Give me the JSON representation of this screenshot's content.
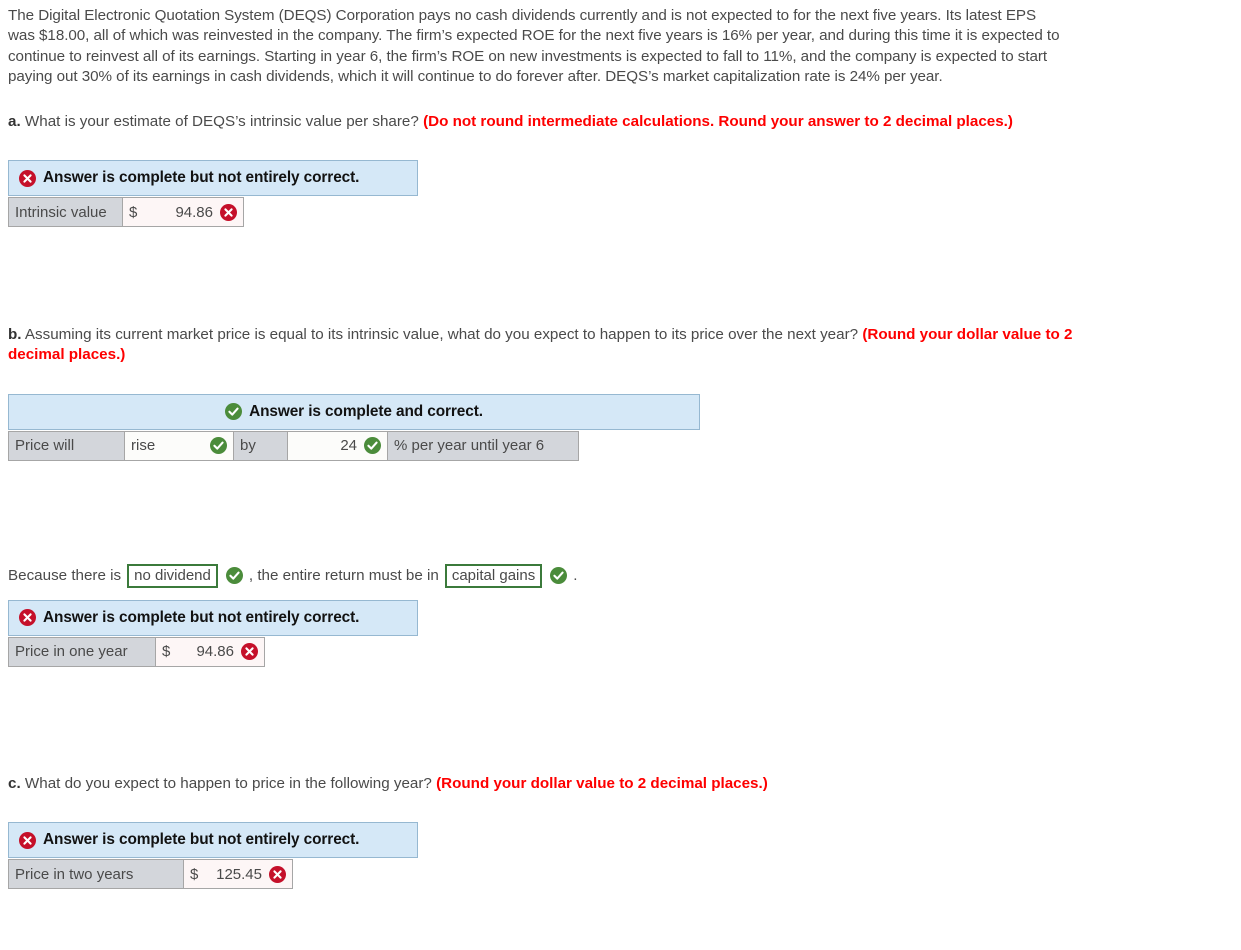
{
  "prompt": "The Digital Electronic Quotation System (DEQS) Corporation pays no cash dividends currently and is not expected to for the next five years. Its latest EPS was $18.00, all of which was reinvested in the company. The firm’s expected ROE for the next five years is 16% per year, and during this time it is expected to continue to reinvest all of its earnings. Starting in year 6, the firm’s ROE on new investments is expected to fall to 11%, and the company is expected to start paying out 30% of its earnings in cash dividends, which it will continue to do forever after. DEQS’s market capitalization rate is 24% per year.",
  "status_messages": {
    "incorrect": "Answer is complete but not entirely correct.",
    "correct": "Answer is complete and correct."
  },
  "colors": {
    "alert_background": "#d5e8f7",
    "alert_border": "#96b8d1",
    "label_cell": "#d3d6db",
    "value_cell": "#fdf6f6",
    "note_red": "#fe0000",
    "icon_red": "#c5102a",
    "icon_green": "#4b8c3b",
    "select_border": "#3b7a3b"
  },
  "parts": {
    "a": {
      "letter": "a.",
      "question": "What is your estimate of DEQS’s intrinsic value per share?",
      "note": "(Do not round intermediate calculations. Round your answer to 2 decimal places.)",
      "status": "incorrect",
      "row": {
        "label": "Intrinsic value",
        "currency": "$",
        "value": "94.86",
        "mark": "incorrect"
      }
    },
    "b": {
      "letter": "b.",
      "question": "Assuming its current market price is equal to its intrinsic value, what do you expect to happen to its price over the next year?",
      "note": "(Round your dollar value to 2 decimal places.)",
      "status": "correct",
      "row": {
        "label": "Price will",
        "direction": "rise",
        "direction_mark": "correct",
        "by_label": "by",
        "amount": "24",
        "amount_mark": "correct",
        "unit_label": "% per year until year 6"
      },
      "sentence": {
        "lead": "Because there is",
        "select1": "no dividend",
        "select1_mark": "correct",
        "middle": ", the entire return must be in",
        "select2": "capital gains",
        "select2_mark": "correct",
        "end": "."
      },
      "status2": "incorrect",
      "row2": {
        "label": "Price in one year",
        "currency": "$",
        "value": "94.86",
        "mark": "incorrect"
      }
    },
    "c": {
      "letter": "c.",
      "question": "What do you expect to happen to price in the following year?",
      "note": "(Round your dollar value to 2 decimal places.)",
      "status": "incorrect",
      "row": {
        "label": "Price in two years",
        "currency": "$",
        "value": "125.45",
        "mark": "incorrect"
      }
    }
  }
}
